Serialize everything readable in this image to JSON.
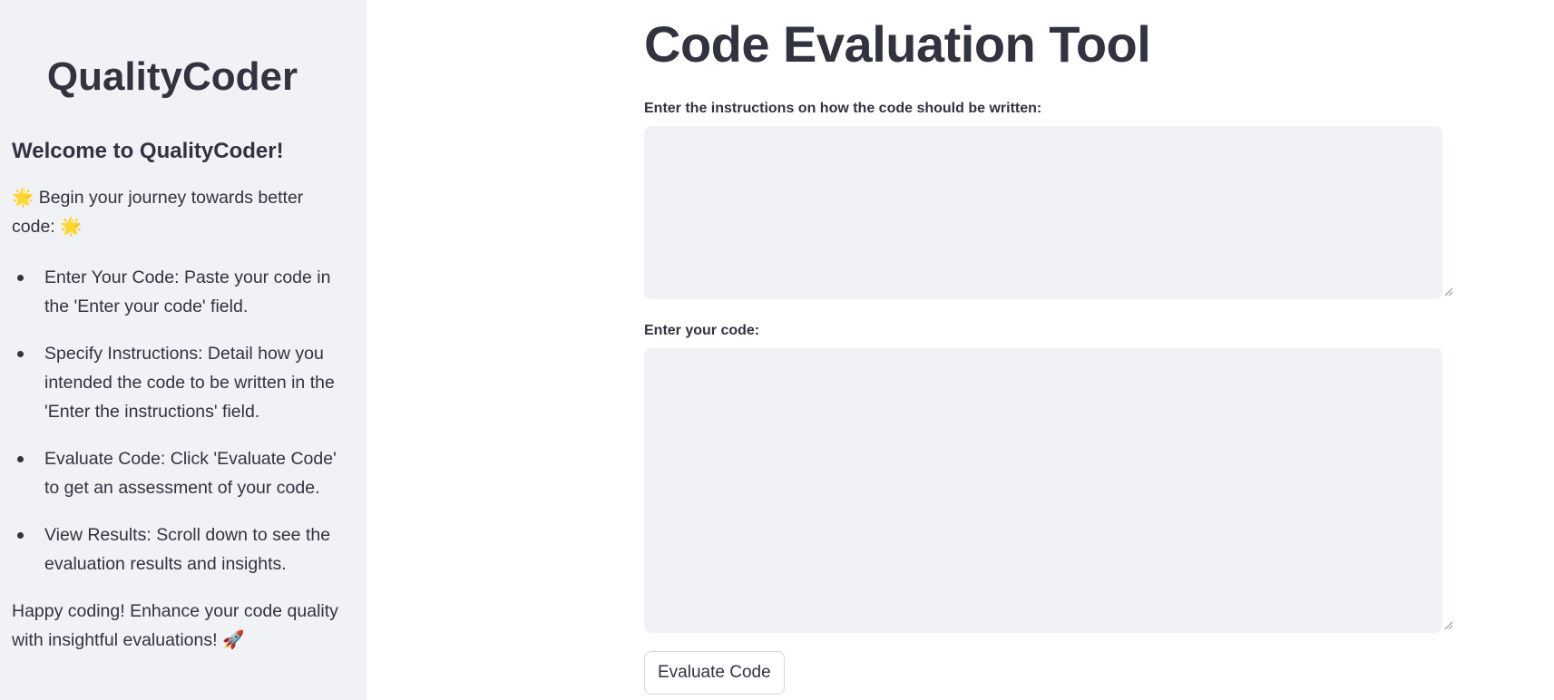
{
  "sidebar": {
    "title": "QualityCoder",
    "welcome": "Welcome to QualityCoder!",
    "intro_text": "Begin your journey towards better code:",
    "intro_emoji": "🌟",
    "steps": [
      "Enter Your Code: Paste your code in the 'Enter your code' field.",
      "Specify Instructions: Detail how you intended the code to be written in the 'Enter the instructions' field.",
      "Evaluate Code: Click 'Evaluate Code' to get an assessment of your code.",
      "View Results: Scroll down to see the evaluation results and insights."
    ],
    "outro_text": "Happy coding! Enhance your code quality with insightful evaluations!",
    "outro_emoji": "🚀"
  },
  "main": {
    "title": "Code Evaluation Tool",
    "instructions_label": "Enter the instructions on how the code should be written:",
    "instructions_value": "",
    "code_label": "Enter your code:",
    "code_value": "",
    "evaluate_button": "Evaluate Code"
  },
  "colors": {
    "sidebar_bg": "#f0f2f6",
    "text": "#31333f",
    "textarea_bg": "#f0f2f6",
    "button_border": "#d6d6d9"
  },
  "icons": {
    "intro": "sun-emoji-icon",
    "outro": "rocket-emoji-icon",
    "resize": "resize-grip-icon"
  }
}
